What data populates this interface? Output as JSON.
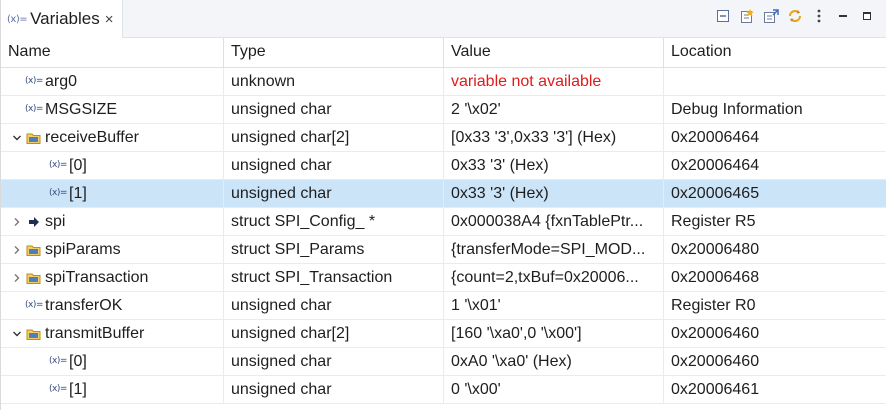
{
  "tab": {
    "icon": "(x)=",
    "label": "Variables",
    "close": "×"
  },
  "toolbar": [
    {
      "name": "collapse-all-icon"
    },
    {
      "name": "show-type-names-icon"
    },
    {
      "name": "add-global-variables-icon"
    },
    {
      "name": "refresh-icon"
    },
    {
      "name": "view-menu-icon"
    },
    {
      "name": "minimize-icon"
    },
    {
      "name": "maximize-icon"
    }
  ],
  "columns": [
    "Name",
    "Type",
    "Value",
    "Location"
  ],
  "colors": {
    "selection": "#cce4f7",
    "error": "#e11b1b"
  },
  "rows": [
    {
      "depth": 0,
      "twisty": "none",
      "icon": "variable-icon",
      "name": "arg0",
      "type": "unknown",
      "value": "variable not available",
      "location": "",
      "error": true
    },
    {
      "depth": 0,
      "twisty": "none",
      "icon": "variable-icon",
      "name": "MSGSIZE",
      "type": "unsigned char",
      "value": "2 '\\x02'",
      "location": "Debug Information"
    },
    {
      "depth": 0,
      "twisty": "expanded",
      "icon": "struct-icon",
      "name": "receiveBuffer",
      "type": "unsigned char[2]",
      "value": "[0x33 '3',0x33 '3'] (Hex)",
      "location": "0x20006464"
    },
    {
      "depth": 1,
      "twisty": "none",
      "icon": "variable-icon",
      "name": "[0]",
      "type": "unsigned char",
      "value": "0x33 '3' (Hex)",
      "location": "0x20006464"
    },
    {
      "depth": 1,
      "twisty": "none",
      "icon": "variable-icon",
      "name": "[1]",
      "type": "unsigned char",
      "value": "0x33 '3' (Hex)",
      "location": "0x20006465",
      "selected": true
    },
    {
      "depth": 0,
      "twisty": "collapsed",
      "icon": "pointer-icon",
      "name": "spi",
      "type": "struct SPI_Config_ *",
      "value": "0x000038A4 {fxnTablePtr...",
      "location": "Register R5"
    },
    {
      "depth": 0,
      "twisty": "collapsed",
      "icon": "struct-icon",
      "name": "spiParams",
      "type": "struct SPI_Params",
      "value": "{transferMode=SPI_MOD...",
      "location": "0x20006480"
    },
    {
      "depth": 0,
      "twisty": "collapsed",
      "icon": "struct-icon",
      "name": "spiTransaction",
      "type": "struct SPI_Transaction",
      "value": "{count=2,txBuf=0x20006...",
      "location": "0x20006468"
    },
    {
      "depth": 0,
      "twisty": "none",
      "icon": "variable-icon",
      "name": "transferOK",
      "type": "unsigned char",
      "value": "1 '\\x01'",
      "location": "Register R0"
    },
    {
      "depth": 0,
      "twisty": "expanded",
      "icon": "struct-icon",
      "name": "transmitBuffer",
      "type": "unsigned char[2]",
      "value": "[160 '\\xa0',0 '\\x00']",
      "location": "0x20006460"
    },
    {
      "depth": 1,
      "twisty": "none",
      "icon": "variable-icon",
      "name": "[0]",
      "type": "unsigned char",
      "value": "0xA0 '\\xa0' (Hex)",
      "location": "0x20006460"
    },
    {
      "depth": 1,
      "twisty": "none",
      "icon": "variable-icon",
      "name": "[1]",
      "type": "unsigned char",
      "value": "0 '\\x00'",
      "location": "0x20006461"
    }
  ]
}
